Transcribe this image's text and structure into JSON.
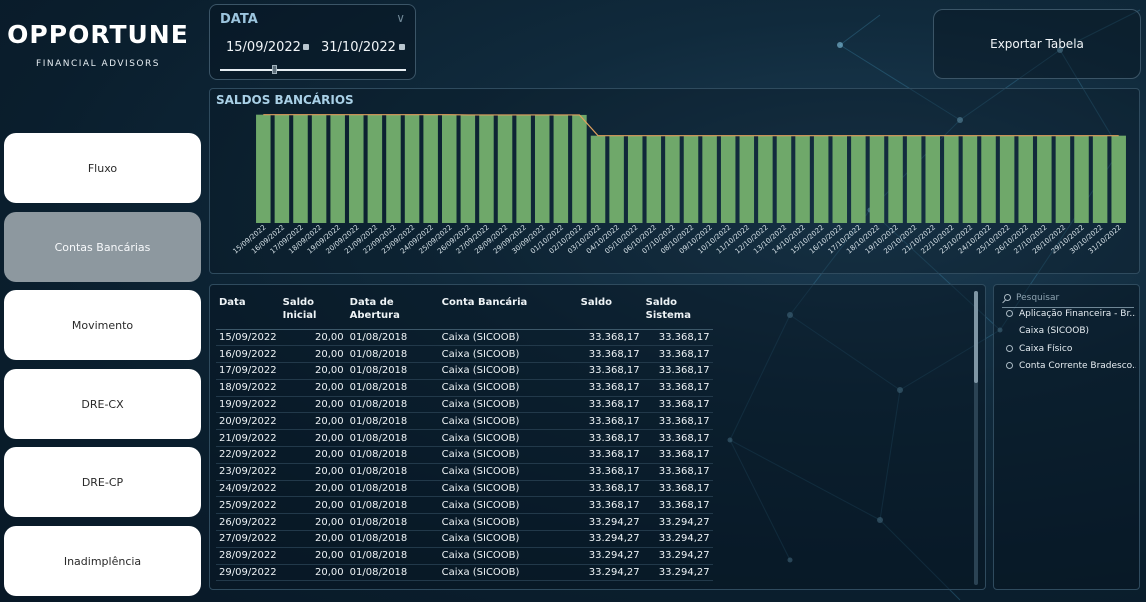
{
  "brand": {
    "title": "OPPORTUNE",
    "subtitle": "FINANCIAL ADVISORS"
  },
  "nav": {
    "items": [
      {
        "label": "Fluxo",
        "active": false
      },
      {
        "label": "Contas Bancárias",
        "active": true
      },
      {
        "label": "Movimento",
        "active": false
      },
      {
        "label": "DRE-CX",
        "active": false
      },
      {
        "label": "DRE-CP",
        "active": false
      },
      {
        "label": "Inadimplência",
        "active": false
      }
    ]
  },
  "date_filter": {
    "title": "DATA",
    "start": "15/09/2022",
    "end": "31/10/2022"
  },
  "export": {
    "label": "Exportar Tabela"
  },
  "chart_data": {
    "type": "bar",
    "title": "SALDOS BANCÁRIOS",
    "xlabel": "",
    "ylabel": "",
    "categories": [
      "15/09/2022",
      "16/09/2022",
      "17/09/2022",
      "18/09/2022",
      "19/09/2022",
      "20/09/2022",
      "21/09/2022",
      "22/09/2022",
      "23/09/2022",
      "24/09/2022",
      "25/09/2022",
      "26/09/2022",
      "27/09/2022",
      "28/09/2022",
      "29/09/2022",
      "30/09/2022",
      "01/10/2022",
      "02/10/2022",
      "03/10/2022",
      "04/10/2022",
      "05/10/2022",
      "06/10/2022",
      "07/10/2022",
      "08/10/2022",
      "09/10/2022",
      "10/10/2022",
      "11/10/2022",
      "12/10/2022",
      "13/10/2022",
      "14/10/2022",
      "15/10/2022",
      "16/10/2022",
      "17/10/2022",
      "18/10/2022",
      "19/10/2022",
      "20/10/2022",
      "21/10/2022",
      "22/10/2022",
      "23/10/2022",
      "24/10/2022",
      "25/10/2022",
      "26/10/2022",
      "27/10/2022",
      "28/10/2022",
      "29/10/2022",
      "30/10/2022",
      "31/10/2022"
    ],
    "values": [
      33368,
      33368,
      33368,
      33368,
      33368,
      33368,
      33368,
      33368,
      33368,
      33368,
      33368,
      33294,
      33294,
      33294,
      33294,
      33294,
      33294,
      33294,
      26900,
      26900,
      26900,
      26900,
      26900,
      26900,
      26900,
      26900,
      26900,
      26900,
      26900,
      26900,
      26900,
      26900,
      26900,
      26900,
      26900,
      26900,
      26900,
      26900,
      26900,
      26900,
      26900,
      26900,
      26900,
      26900,
      26900,
      26900,
      26900
    ],
    "ylim": [
      0,
      34500
    ],
    "colors": {
      "bar": "#6fa86a",
      "line": "#e0a15e"
    }
  },
  "table": {
    "columns": [
      "Data",
      "Saldo Inicial",
      "Data de Abertura",
      "Conta Bancária",
      "Saldo",
      "Saldo Sistema"
    ],
    "rows": [
      [
        "15/09/2022",
        "20,00",
        "01/08/2018",
        "Caixa (SICOOB)",
        "33.368,17",
        "33.368,17"
      ],
      [
        "16/09/2022",
        "20,00",
        "01/08/2018",
        "Caixa (SICOOB)",
        "33.368,17",
        "33.368,17"
      ],
      [
        "17/09/2022",
        "20,00",
        "01/08/2018",
        "Caixa (SICOOB)",
        "33.368,17",
        "33.368,17"
      ],
      [
        "18/09/2022",
        "20,00",
        "01/08/2018",
        "Caixa (SICOOB)",
        "33.368,17",
        "33.368,17"
      ],
      [
        "19/09/2022",
        "20,00",
        "01/08/2018",
        "Caixa (SICOOB)",
        "33.368,17",
        "33.368,17"
      ],
      [
        "20/09/2022",
        "20,00",
        "01/08/2018",
        "Caixa (SICOOB)",
        "33.368,17",
        "33.368,17"
      ],
      [
        "21/09/2022",
        "20,00",
        "01/08/2018",
        "Caixa (SICOOB)",
        "33.368,17",
        "33.368,17"
      ],
      [
        "22/09/2022",
        "20,00",
        "01/08/2018",
        "Caixa (SICOOB)",
        "33.368,17",
        "33.368,17"
      ],
      [
        "23/09/2022",
        "20,00",
        "01/08/2018",
        "Caixa (SICOOB)",
        "33.368,17",
        "33.368,17"
      ],
      [
        "24/09/2022",
        "20,00",
        "01/08/2018",
        "Caixa (SICOOB)",
        "33.368,17",
        "33.368,17"
      ],
      [
        "25/09/2022",
        "20,00",
        "01/08/2018",
        "Caixa (SICOOB)",
        "33.368,17",
        "33.368,17"
      ],
      [
        "26/09/2022",
        "20,00",
        "01/08/2018",
        "Caixa (SICOOB)",
        "33.294,27",
        "33.294,27"
      ],
      [
        "27/09/2022",
        "20,00",
        "01/08/2018",
        "Caixa (SICOOB)",
        "33.294,27",
        "33.294,27"
      ],
      [
        "28/09/2022",
        "20,00",
        "01/08/2018",
        "Caixa (SICOOB)",
        "33.294,27",
        "33.294,27"
      ],
      [
        "29/09/2022",
        "20,00",
        "01/08/2018",
        "Caixa (SICOOB)",
        "33.294,27",
        "33.294,27"
      ]
    ]
  },
  "slicer": {
    "search_placeholder": "Pesquisar",
    "items": [
      {
        "label": "Aplicação Financeira - Br...",
        "selected": false
      },
      {
        "label": "Caixa (SICOOB)",
        "selected": true
      },
      {
        "label": "Caixa Físico",
        "selected": false
      },
      {
        "label": "Conta Corrente Bradesco...",
        "selected": false
      }
    ]
  }
}
